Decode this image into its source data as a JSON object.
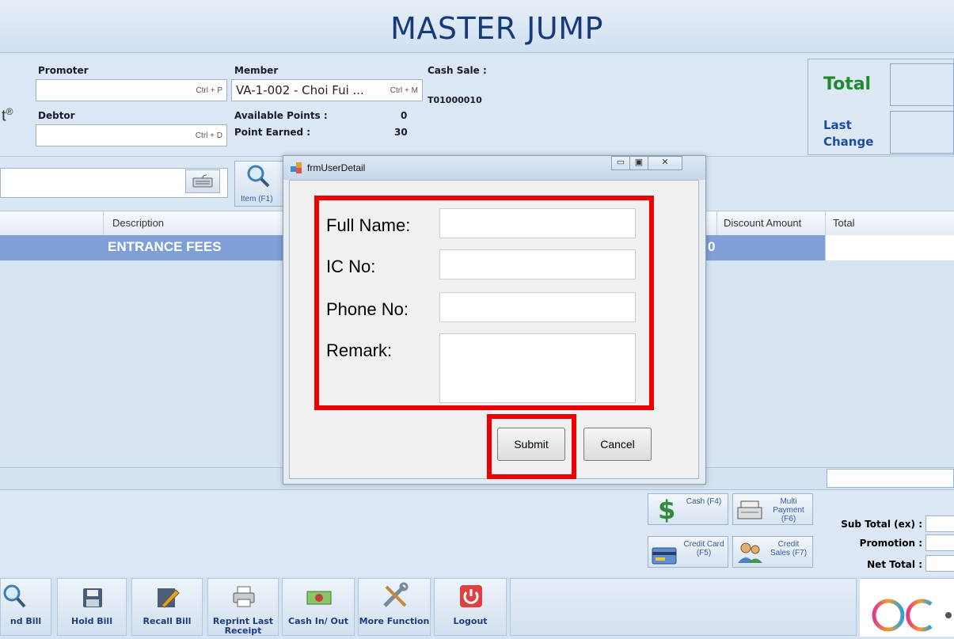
{
  "app": {
    "title": "MASTER JUMP"
  },
  "header": {
    "promoter_label": "Promoter",
    "promoter_shortcut": "Ctrl + P",
    "debtor_label": "Debtor",
    "debtor_shortcut": "Ctrl + D",
    "member_label": "Member",
    "member_value": "VA-1-002 - Choi Fui ...",
    "member_shortcut": "Ctrl + M",
    "available_points_label": "Available Points :",
    "available_points_value": "0",
    "point_earned_label": "Point Earned :",
    "point_earned_value": "30",
    "cash_sale_label": "Cash Sale :",
    "cash_sale_no": "T01000010",
    "total_label": "Total",
    "last_change_label": "Last Change",
    "brand_fragment": "t",
    "brand_mark": "®"
  },
  "toolbar": {
    "item_button_label": "Item (F1)"
  },
  "grid": {
    "columns": [
      "Description",
      "Discount Amount",
      "Total"
    ],
    "rows": [
      {
        "description": "ENTRANCE FEES",
        "partial_value": "0"
      }
    ]
  },
  "payment": {
    "cash": "Cash (F4)",
    "multi_payment": "Multi Payment (F6)",
    "credit_card": "Credit Card (F5)",
    "credit_sales": "Credit Sales (F7)"
  },
  "summary": {
    "subtotal_label": "Sub Total (ex) :",
    "promotion_label": "Promotion :",
    "net_total_label": "Net Total :"
  },
  "bottom_buttons": [
    {
      "label": "nd Bill",
      "icon": "magnifier-icon"
    },
    {
      "label": "Hold Bill",
      "icon": "floppy-disk-icon"
    },
    {
      "label": "Recall Bill",
      "icon": "recall-icon"
    },
    {
      "label": "Reprint Last Receipt",
      "icon": "printer-icon"
    },
    {
      "label": "Cash In/ Out",
      "icon": "cash-icon"
    },
    {
      "label": "More Function",
      "icon": "tools-icon"
    },
    {
      "label": "Logout",
      "icon": "power-icon"
    }
  ],
  "dialog": {
    "title": "frmUserDetail",
    "full_name_label": "Full Name:",
    "ic_no_label": "IC No:",
    "phone_no_label": "Phone No:",
    "remark_label": "Remark:",
    "full_name_value": "",
    "ic_no_value": "",
    "phone_no_value": "",
    "remark_value": "",
    "submit_label": "Submit",
    "cancel_label": "Cancel"
  },
  "colors": {
    "highlight_red": "#ee0000",
    "title_blue": "#173b7a",
    "total_green": "#1f8a2f",
    "row_selected": "#7f9fd6"
  }
}
